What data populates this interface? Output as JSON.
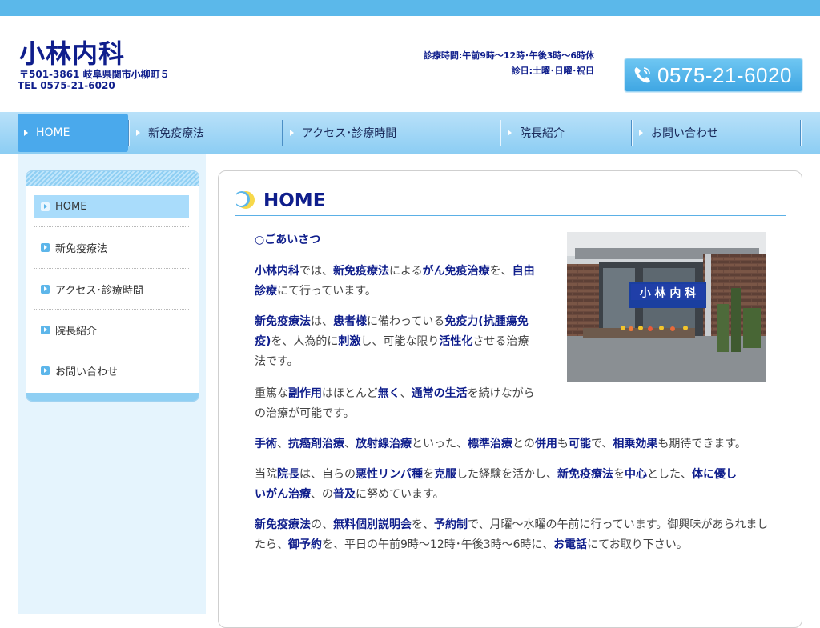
{
  "header": {
    "title": "小林内科",
    "address": "〒501-3861 岐阜県関市小柳町５",
    "tel": "TEL 0575-21-6020",
    "hours": "診療時間:午前9時～12時･午後3時～6時休",
    "closed": "診日:土曜･日曜･祝日",
    "phone_number": "0575-21-6020",
    "phone_icon": "phone-icon"
  },
  "nav": {
    "items": [
      {
        "label": "HOME"
      },
      {
        "label": "新免疫療法"
      },
      {
        "label": "アクセス･診療時間"
      },
      {
        "label": "院長紹介"
      },
      {
        "label": "お問い合わせ"
      }
    ]
  },
  "sidebar": {
    "items": [
      {
        "label": "HOME"
      },
      {
        "label": "新免疫療法"
      },
      {
        "label": "アクセス･診療時間"
      },
      {
        "label": "院長紹介"
      },
      {
        "label": "お問い合わせ"
      }
    ]
  },
  "main": {
    "title": "HOME",
    "photo_sign": "小 林 内 科",
    "greeting": "○ごあいさつ",
    "p1": [
      [
        {
          "t": "小林内科",
          "b": true
        },
        {
          "t": "では、"
        },
        {
          "t": "新免疫療法",
          "b": true
        },
        {
          "t": "による"
        },
        {
          "t": "がん免疫治療",
          "b": true
        },
        {
          "t": "を、"
        },
        {
          "t": "自由",
          "b": true
        }
      ],
      [
        {
          "t": "診療",
          "b": true
        },
        {
          "t": "にて行っています。"
        }
      ]
    ],
    "p2": [
      [
        {
          "t": "新免疫療法",
          "b": true
        },
        {
          "t": "は、"
        },
        {
          "t": "患者様",
          "b": true
        },
        {
          "t": "に備わっている"
        },
        {
          "t": "免疫力(抗腫瘍免",
          "b": true
        }
      ],
      [
        {
          "t": "疫)",
          "b": true
        },
        {
          "t": "を、人為的に"
        },
        {
          "t": "刺激",
          "b": true
        },
        {
          "t": "し、可能な限り"
        },
        {
          "t": "活性化",
          "b": true
        },
        {
          "t": "させる治療"
        }
      ],
      [
        {
          "t": "法です。"
        }
      ]
    ],
    "p3": [
      [
        {
          "t": "重篤な"
        },
        {
          "t": "副作用",
          "b": true
        },
        {
          "t": "はほとんど"
        },
        {
          "t": "無く",
          "b": true
        },
        {
          "t": "、"
        },
        {
          "t": "通常の生活",
          "b": true
        },
        {
          "t": "を続けながら"
        }
      ],
      [
        {
          "t": "の治療が可能です。"
        }
      ]
    ],
    "p4": [
      [
        {
          "t": "手術",
          "b": true
        },
        {
          "t": "、"
        },
        {
          "t": "抗癌剤治療",
          "b": true
        },
        {
          "t": "、"
        },
        {
          "t": "放射線治療",
          "b": true
        },
        {
          "t": "といった、"
        },
        {
          "t": "標準治療",
          "b": true
        },
        {
          "t": "との"
        },
        {
          "t": "併用",
          "b": true
        },
        {
          "t": "も"
        },
        {
          "t": "可能",
          "b": true
        },
        {
          "t": "で、"
        },
        {
          "t": "相乗効果",
          "b": true
        },
        {
          "t": "も期待できます。"
        }
      ]
    ],
    "p5": [
      [
        {
          "t": "当院"
        },
        {
          "t": "院長",
          "b": true
        },
        {
          "t": "は、自らの"
        },
        {
          "t": "悪性リンパ種",
          "b": true
        },
        {
          "t": "を"
        },
        {
          "t": "克服",
          "b": true
        },
        {
          "t": "した経験を活かし、"
        },
        {
          "t": "新免疫療法",
          "b": true
        },
        {
          "t": "を"
        },
        {
          "t": "中心",
          "b": true
        },
        {
          "t": "とした、"
        },
        {
          "t": "体に優し",
          "b": true
        }
      ],
      [
        {
          "t": "いがん治療",
          "b": true
        },
        {
          "t": "、の"
        },
        {
          "t": "普及",
          "b": true
        },
        {
          "t": "に努めています。"
        }
      ]
    ],
    "p6": [
      [
        {
          "t": "新免疫療法",
          "b": true
        },
        {
          "t": "の、"
        },
        {
          "t": "無料個別説明会",
          "b": true
        },
        {
          "t": "を、"
        },
        {
          "t": "予約制",
          "b": true
        },
        {
          "t": "で、月曜～水曜の午前に行っています。御興味があられまし"
        }
      ],
      [
        {
          "t": "たら、"
        },
        {
          "t": "御予約",
          "b": true
        },
        {
          "t": "を、平日の午前9時～12時･午後3時～6時に、"
        },
        {
          "t": "お電話",
          "b": true
        },
        {
          "t": "にてお取り下さい。"
        }
      ]
    ]
  },
  "colors": {
    "accent": "#5bb8ea",
    "title": "#0f1e8c",
    "nav_active": "#4aa9ec"
  }
}
